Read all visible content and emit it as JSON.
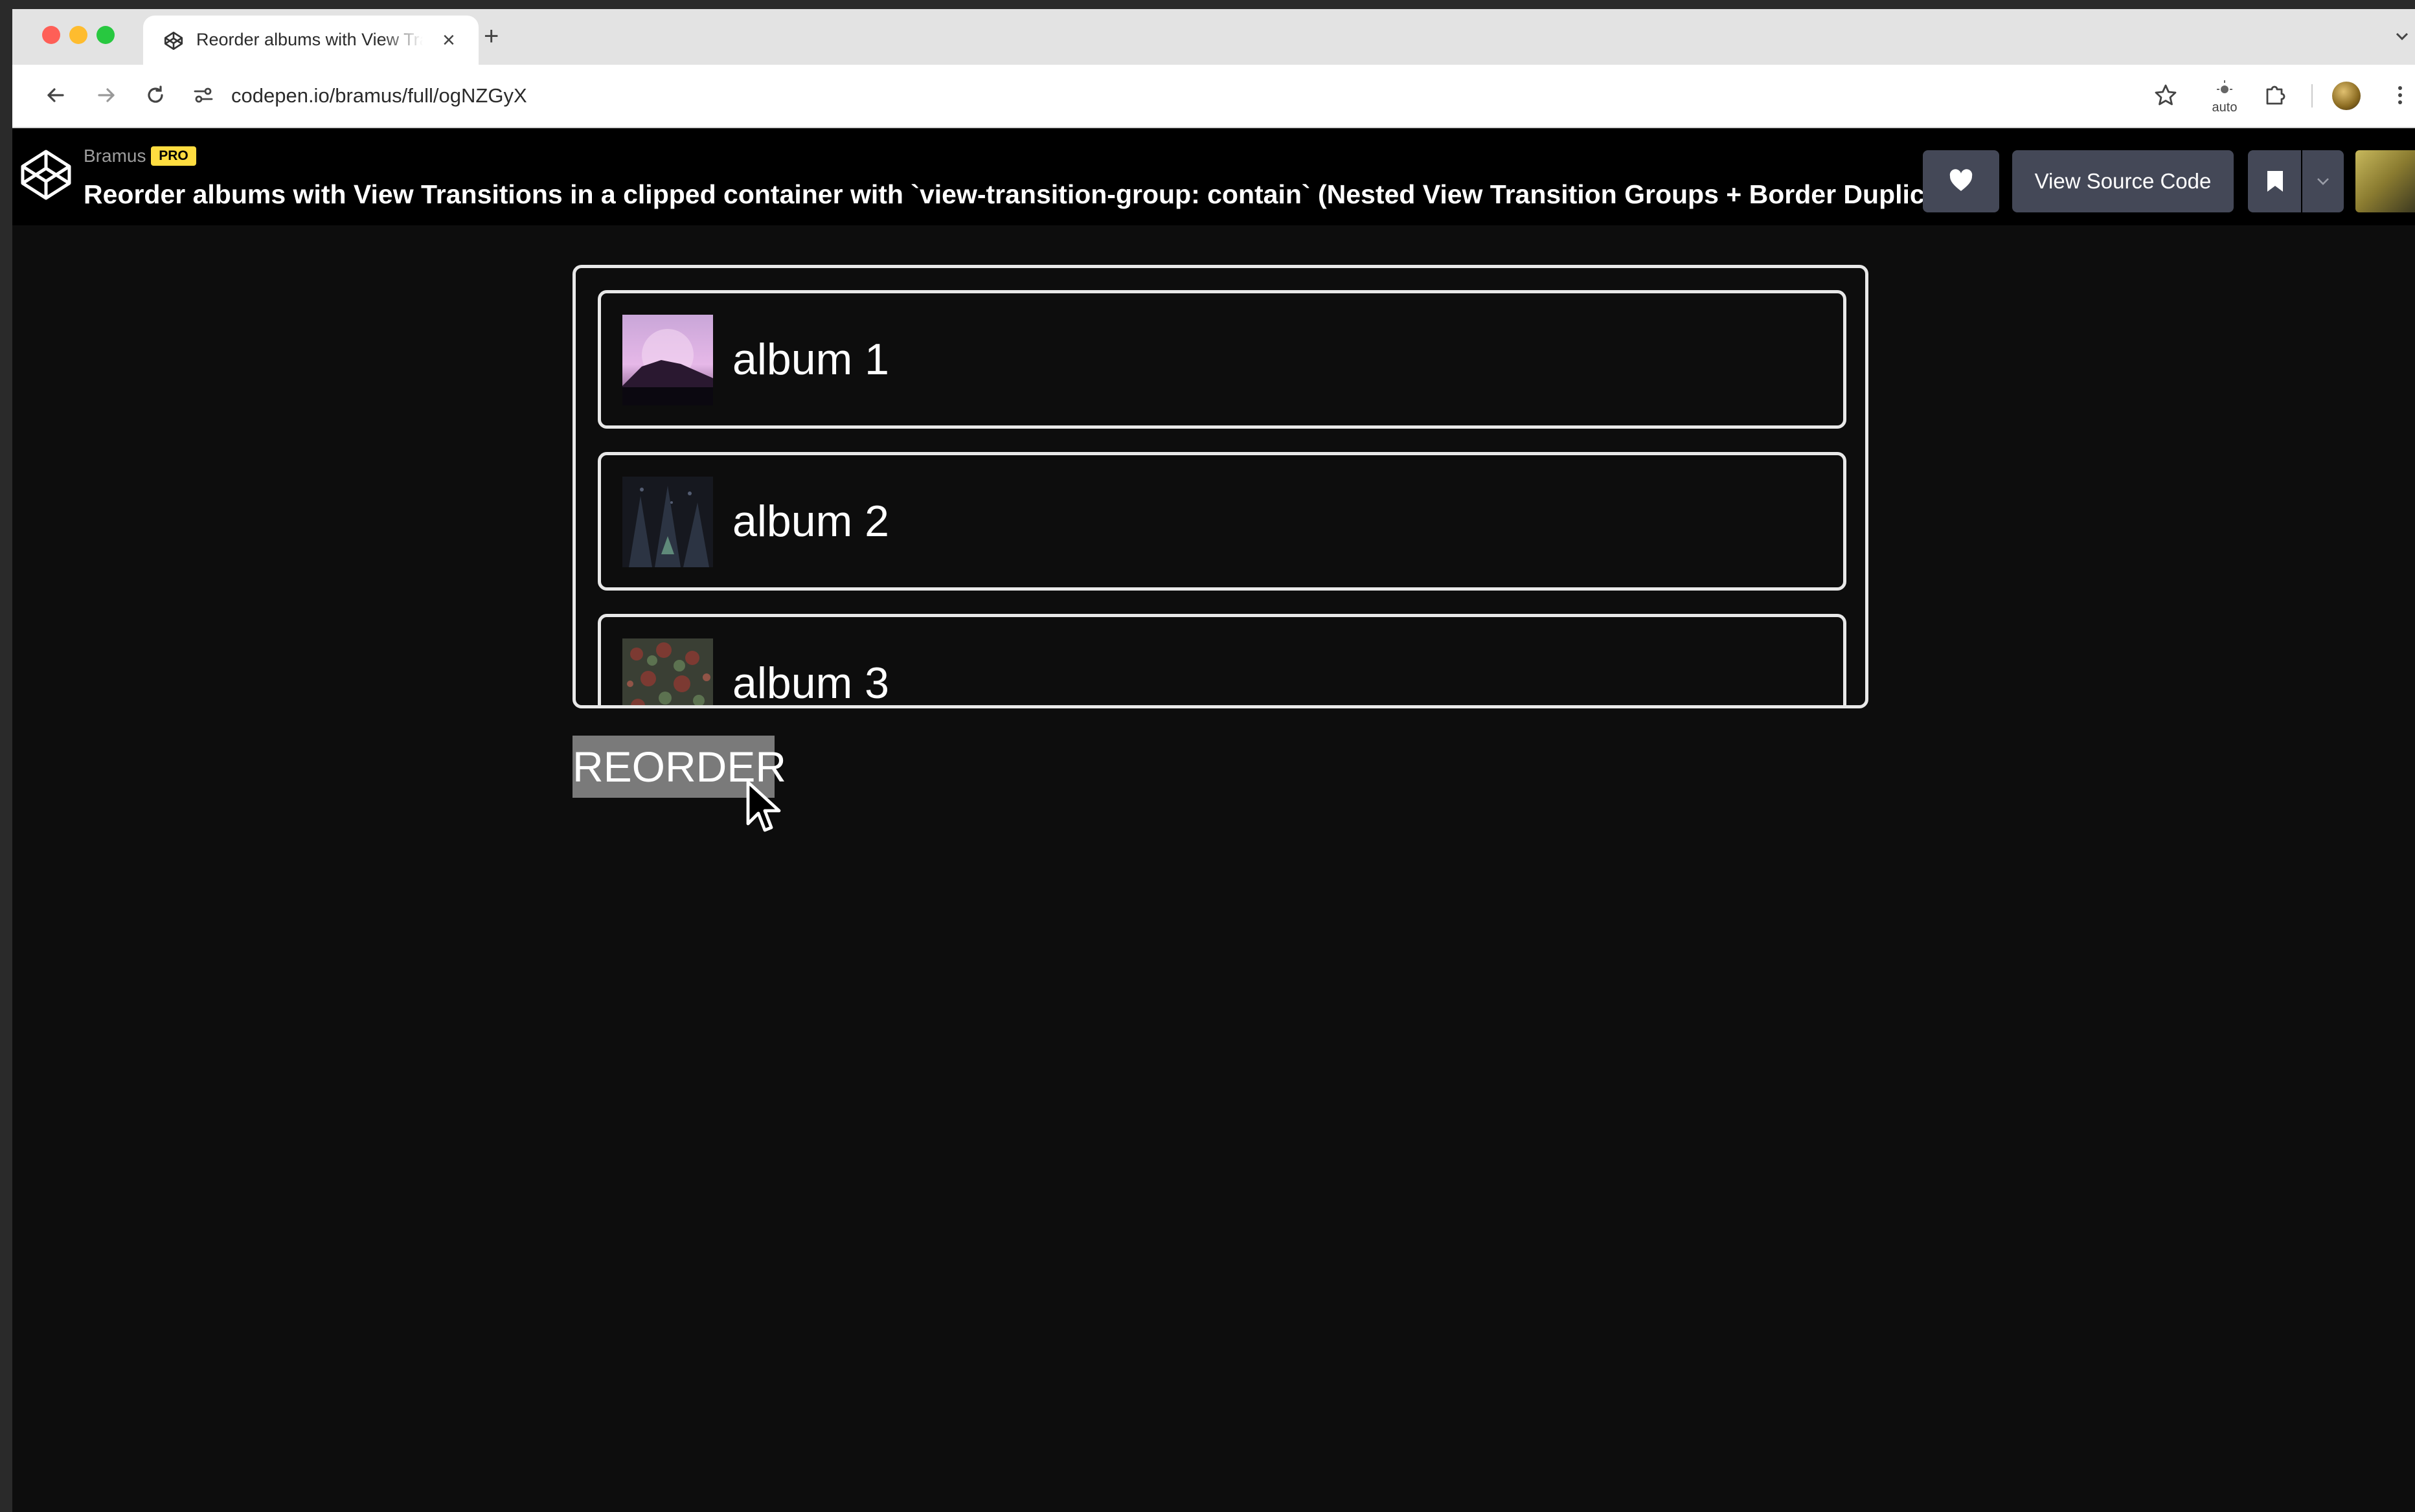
{
  "browser": {
    "tab": {
      "title": "Reorder albums with View Transitions in a clipped container",
      "favicon": "codepen-icon"
    },
    "url": "codepen.io/bramus/full/ogNZGyX",
    "extension_label": "auto"
  },
  "pen": {
    "author": "Bramus",
    "badge": "PRO",
    "title": "Reorder albums with View Transitions in a clipped container with `view-transition-group: contain` (Nested View Transition Groups + Border Duplicati...",
    "buttons": {
      "view_source": "View Source Code"
    }
  },
  "demo": {
    "albums": [
      {
        "label": "album 1",
        "cover": "purple-mountain-cover"
      },
      {
        "label": "album 2",
        "cover": "dark-forest-cover"
      },
      {
        "label": "album 3",
        "cover": "red-foliage-cover"
      }
    ],
    "reorder_label": "REORDER"
  },
  "colors": {
    "page_background": "#0d0d0d",
    "header_background": "#000000",
    "header_button": "#444857",
    "pro_badge": "#ffdd40",
    "album_border": "#e8e8e8",
    "reorder_button": "#7a7a7a"
  }
}
